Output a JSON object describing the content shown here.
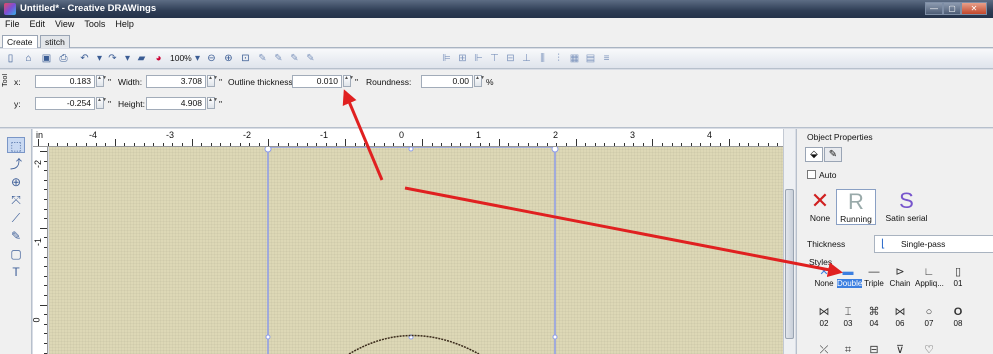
{
  "window": {
    "title": "Untitled* - Creative DRAWings",
    "controls": [
      "—",
      "▢",
      "✕"
    ]
  },
  "menu": [
    "File",
    "Edit",
    "View",
    "Tools",
    "Help"
  ],
  "tabs": [
    "Create",
    "stitch"
  ],
  "toolbar": {
    "zoom": "100%"
  },
  "properties": {
    "x_label": "x:",
    "x_value": "0.183",
    "y_label": "y:",
    "y_value": "-0.254",
    "unit": "\"",
    "width_label": "Width:",
    "width_value": "3.708",
    "height_label": "Height:",
    "height_value": "4.908",
    "outline_label": "Outline thickness:",
    "outline_value": "0.010",
    "roundness_label": "Roundness:",
    "roundness_value": "0.00",
    "roundness_unit": "%",
    "tool_label": "Tool"
  },
  "ruler": {
    "unit": "in",
    "labels": [
      "-4",
      "-3",
      "-2",
      "-1",
      "0",
      "1",
      "2",
      "3",
      "4"
    ],
    "left_labels": [
      "-2",
      "-1",
      "0"
    ]
  },
  "panel": {
    "title": "Object Properties",
    "auto_label": "Auto",
    "stitch_types": [
      "None",
      "Running",
      "Satin serial"
    ],
    "thickness_label": "Thickness",
    "thickness_value": "Single-pass",
    "styles_label": "Styles",
    "styles_row1": [
      "None",
      "Double",
      "Triple",
      "Chain",
      "Appliq...",
      "01"
    ],
    "styles_row2": [
      "02",
      "03",
      "04",
      "06",
      "07",
      "08"
    ]
  },
  "colors": {
    "accent": "#3c7fe0",
    "arrow": "#e02020",
    "canvas": "#ddd8b6",
    "selection": "#8d9ce8"
  }
}
